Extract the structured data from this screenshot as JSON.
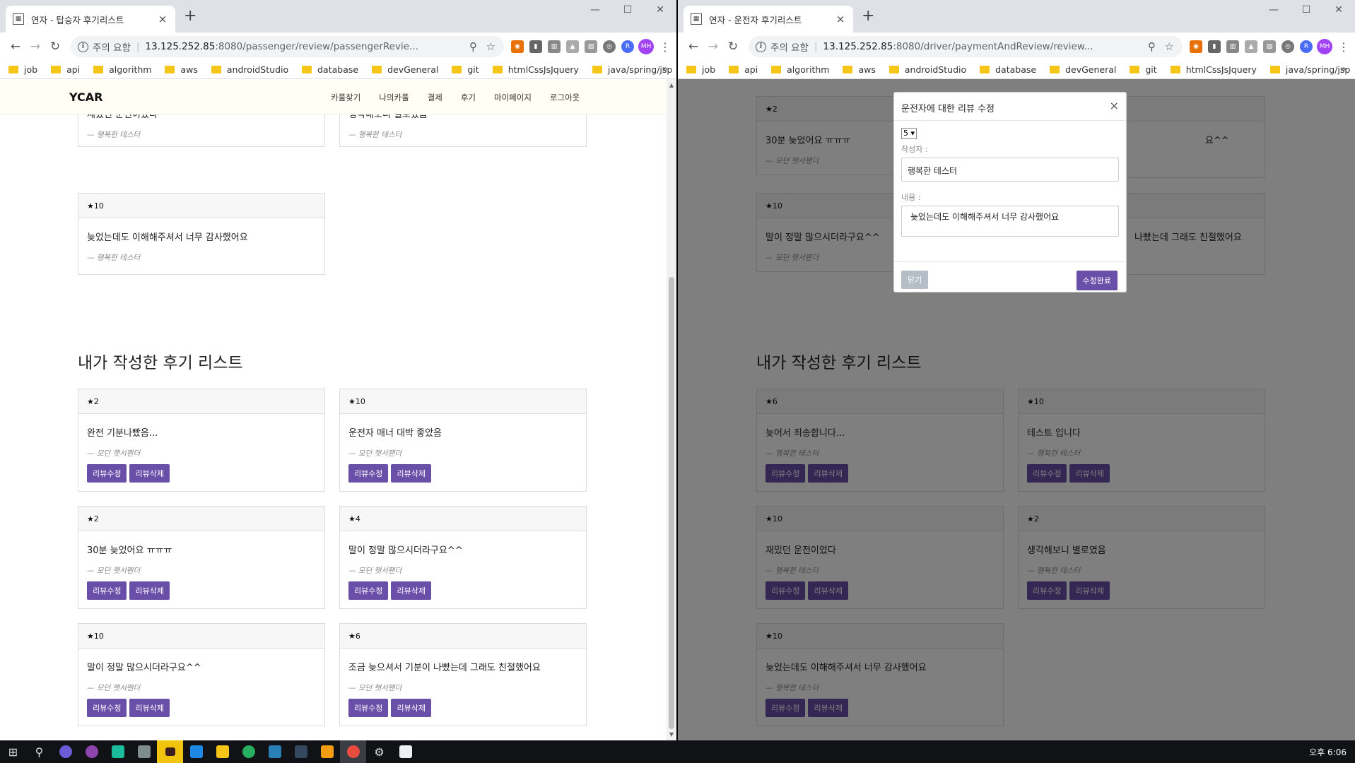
{
  "left": {
    "tab_title": "연자 - 탑승자 후기리스트",
    "url_warning": "주의 요함",
    "url_host": "13.125.252.85",
    "url_path": ":8080/passenger/review/passengerRevie...",
    "brand": "YCAR",
    "menu": [
      "카풀찾기",
      "나의카풀",
      "결제",
      "후기",
      "마이페이지",
      "로그아웃"
    ],
    "top_cards": [
      {
        "text": "재밌던 운전이었다",
        "author": "— 행복한 테스터"
      },
      {
        "text": "생각해보니 별로였음",
        "author": "— 행복한 테스터"
      },
      {
        "rating": "★10",
        "text": "늦었는데도 이해해주셔서 너무 감사했어요",
        "author": "— 행복한 테스터"
      }
    ],
    "section_title": "내가 작성한 후기 리스트",
    "my_cards": [
      {
        "rating": "★2",
        "text": "완전 기분나빴음...",
        "author": "— 모던 햇서팬더"
      },
      {
        "rating": "★10",
        "text": "운전자 매너 대박 좋았음",
        "author": "— 모던 햇서팬더"
      },
      {
        "rating": "★2",
        "text": "30분 늦었어요 ㅠㅠㅠ",
        "author": "— 모던 햇서팬더"
      },
      {
        "rating": "★4",
        "text": "말이 정말 많으시더라구요^^",
        "author": "— 모던 햇서팬더"
      },
      {
        "rating": "★10",
        "text": "말이 정말 많으시더라구요^^",
        "author": "— 모던 햇서팬더"
      },
      {
        "rating": "★6",
        "text": "조금 늦으셔서 기분이 나빴는데 그래도 친절했어요",
        "author": "— 모던 햇서팬더"
      }
    ]
  },
  "right": {
    "tab_title": "연자 - 운전자 후기리스트",
    "url_warning": "주의 요함",
    "url_host": "13.125.252.85",
    "url_path": ":8080/driver/paymentAndReview/review...",
    "top_cards": [
      {
        "rating": "★2",
        "text": "30분 늦었어요 ㅠㅠㅠ",
        "author": "— 모던 햇서팬더"
      },
      {
        "rating": "",
        "text": "요^^",
        "author": ""
      },
      {
        "rating": "★10",
        "text": "말이 정말 많으시더라구요^^",
        "author": "— 모던 햇서팬더"
      },
      {
        "rating": "",
        "text": "나빴는데 그래도 친절했어요",
        "author": ""
      }
    ],
    "section_title": "내가 작성한 후기 리스트",
    "my_cards": [
      {
        "rating": "★6",
        "text": "늦어서 죄송합니다...",
        "author": "— 행복한 테스터"
      },
      {
        "rating": "★10",
        "text": "테스트 입니다",
        "author": "— 행복한 테스터"
      },
      {
        "rating": "★10",
        "text": "재밌던 운전이었다",
        "author": "— 행복한 테스터"
      },
      {
        "rating": "★2",
        "text": "생각해보니 별로였음",
        "author": "— 행복한 테스터"
      },
      {
        "rating": "★10",
        "text": "늦었는데도 이해해주셔서 너무 감사했어요",
        "author": "— 행복한 테스터"
      }
    ],
    "modal": {
      "title": "운전자에 대한 리뷰 수정",
      "rating_value": "5",
      "author_label": "작성자 :",
      "author_value": "행복한 테스터",
      "content_label": "내용 :",
      "content_value": "늦었는데도 이해해주셔서 너무 감사했어요",
      "close_label": "닫기",
      "submit_label": "수정완료"
    }
  },
  "buttons": {
    "edit": "리뷰수정",
    "delete": "리뷰삭제"
  },
  "bookmarks": [
    "job",
    "api",
    "algorithm",
    "aws",
    "androidStudio",
    "database",
    "devGeneral",
    "git",
    "htmlCssJsJquery",
    "java/spring/jsp"
  ],
  "avatar_initials": "MH",
  "taskbar_clock": "오후 6:06",
  "colors": {
    "accent": "#6a4fa8",
    "navbar_bg": "#fffff5"
  }
}
